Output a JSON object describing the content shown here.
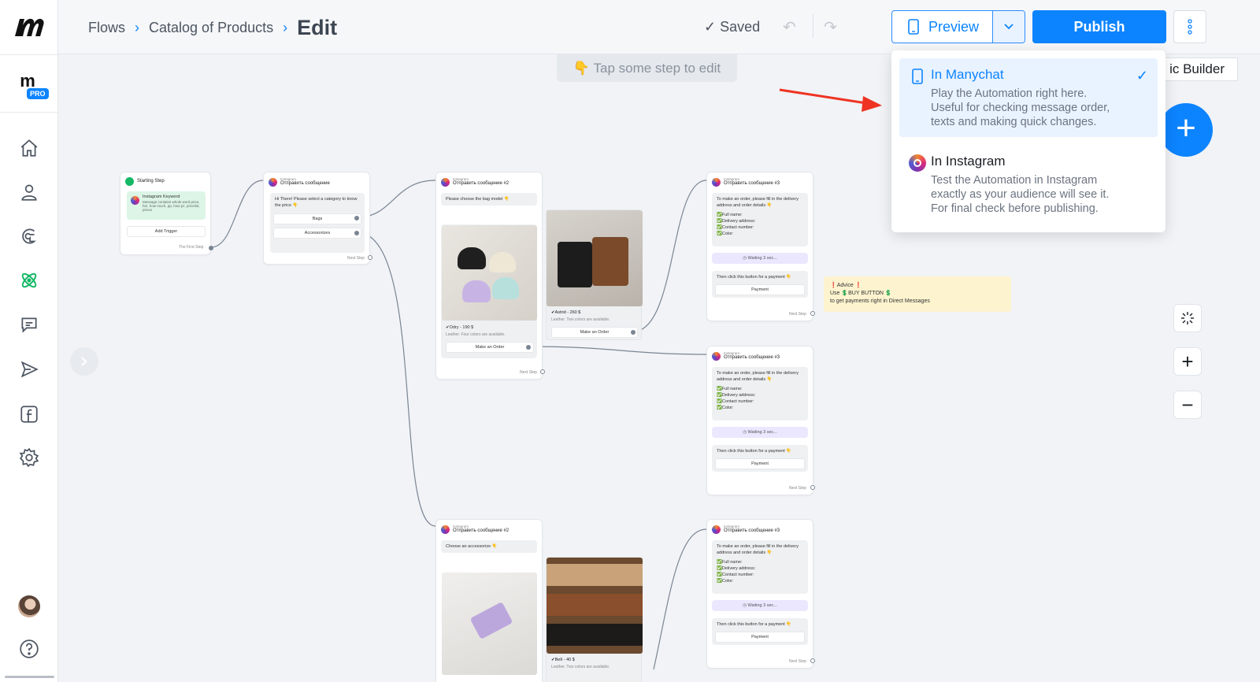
{
  "breadcrumbs": {
    "item1": "Flows",
    "item2": "Catalog of Products",
    "current": "Edit"
  },
  "status": {
    "saved": "Saved"
  },
  "preview_button": {
    "label": "Preview"
  },
  "publish_button": {
    "label": "Publish"
  },
  "canvas_hint": "👇 Tap some step to edit",
  "basic_builder": "ic Builder",
  "sidebar": {
    "pro_badge": "PRO"
  },
  "preview_menu": {
    "manychat": {
      "title": "In Manychat",
      "line1": "Play the Automation right here.",
      "line2": "Useful for checking message order,",
      "line3": "texts and making quick changes."
    },
    "instagram": {
      "title": "In Instagram",
      "line1": "Test the Automation in Instagram",
      "line2": "exactly as your audience will see it.",
      "line3": "For final check before publishing."
    }
  },
  "flow": {
    "start": {
      "title": "Starting Step",
      "trigger_title": "Instagram Keyword",
      "trigger_desc": "Message contains whole word price, hm, how much, pp, how pz, pricelist, prices",
      "add_trigger": "Add Trigger",
      "first_step": "The First Step"
    },
    "msg1": {
      "sub": "Instagram",
      "title": "Отправить сообщение",
      "text": "Hi There! Please select a category to know the price 👇",
      "btn1": "Bags",
      "btn2": "Accessorizes",
      "next": "Next Step"
    },
    "msg2": {
      "sub": "Instagram",
      "title": "Отправить сообщение #2",
      "text": "Please choose the bag model 👇",
      "item1_title": "✔Odry - 190 $",
      "item1_desc": "Leather. Four colors are available.",
      "item1_btn": "Make an Order",
      "item2_title": "✔Astrid - 260 $",
      "item2_desc": "Leather. Two colors are available.",
      "item2_btn": "Make an Order",
      "next": "Next Step"
    },
    "msg3": {
      "sub": "Instagram",
      "title": "Отправить сообщение #3",
      "text_intro": "To make an order, please fill in the delivery address and order details 👇",
      "f1": "✅Full name:",
      "f2": "✅Delivery address:",
      "f3": "✅Contact number:",
      "f4": "✅Color:",
      "wait": "Waiting 3 sec...",
      "then": "Then click this button for a payment 👇",
      "payment": "Payment",
      "next": "Next Step"
    },
    "msg4": {
      "sub": "Instagram",
      "title": "Отправить сообщение #2",
      "text": "Choose an accessorize 👇",
      "item2_title": "✔Belt - 40 $",
      "item2_desc": "Leather. Two colors are available."
    },
    "advice": {
      "line1": "❗Advice ❗",
      "line2": "Use 💲BUY BUTTON 💲",
      "line3": "to get payments right in Direct Messages"
    }
  }
}
